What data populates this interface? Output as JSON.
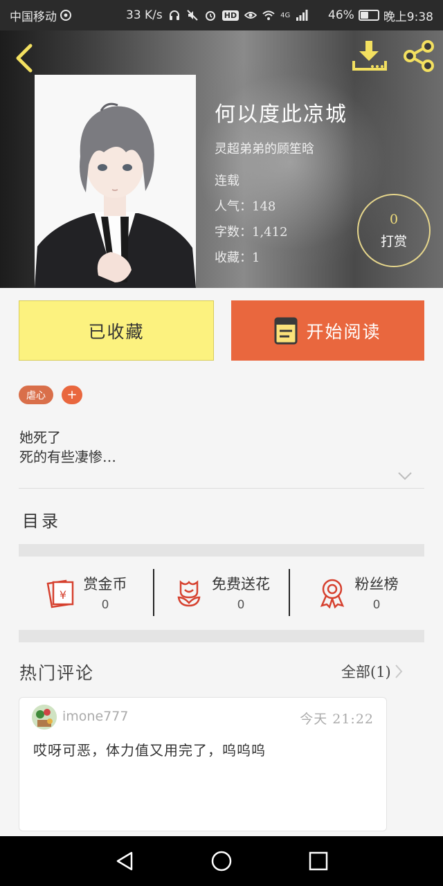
{
  "status_bar": {
    "carrier": "中国移动",
    "speed": "33 K/s",
    "hd": "HD",
    "network": "4G",
    "battery_percent": "46%",
    "battery_level": 0.46,
    "time": "晚上9:38"
  },
  "book": {
    "title": "何以度此凉城",
    "author": "灵超弟弟的顾笙晗",
    "status": "连载",
    "popularity": "人气：148",
    "word_count": "字数：1,412",
    "favorites": "收藏：1"
  },
  "tip": {
    "count": "0",
    "label": "打赏"
  },
  "actions": {
    "collected_label": "已收藏",
    "read_label": "开始阅读"
  },
  "tags": {
    "items": [
      "虐心"
    ],
    "add_label": "+"
  },
  "synopsis": {
    "line1": "她死了",
    "line2": "死的有些凄惨…"
  },
  "toc": {
    "title": "目录"
  },
  "stats": [
    {
      "label": "赏金币",
      "value": "0",
      "icon": "gold-coin-icon"
    },
    {
      "label": "免费送花",
      "value": "0",
      "icon": "flower-icon"
    },
    {
      "label": "粉丝榜",
      "value": "0",
      "icon": "medal-icon"
    }
  ],
  "comments": {
    "title": "热门评论",
    "all_label": "全部(1)",
    "items": [
      {
        "user": "imone777",
        "time": "今天  21:22",
        "text": "哎呀可恶，体力值又用完了，呜呜呜"
      }
    ]
  },
  "colors": {
    "accent": "#e9673e",
    "collected_bg": "#fcf27f",
    "tip_gold": "#f1de7c",
    "icon_red": "#d6412f"
  }
}
